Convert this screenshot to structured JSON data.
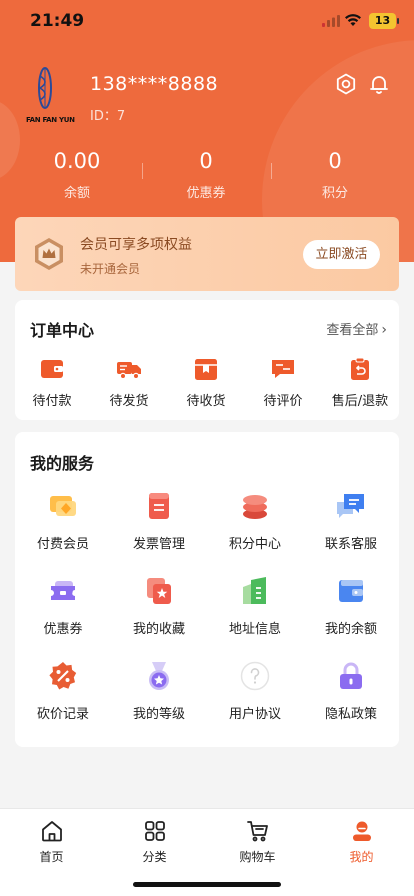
{
  "status_bar": {
    "time": "21:49",
    "battery": "13"
  },
  "profile": {
    "logo_text": "FAN FAN YUN",
    "phone": "138****8888",
    "user_id": "ID：7"
  },
  "stats": [
    {
      "value": "0.00",
      "label": "余额"
    },
    {
      "value": "0",
      "label": "优惠券"
    },
    {
      "value": "0",
      "label": "积分"
    }
  ],
  "vip": {
    "title": "会员可享多项权益",
    "subtitle": "未开通会员",
    "button": "立即激活"
  },
  "orders": {
    "title": "订单中心",
    "see_all": "查看全部",
    "items": [
      {
        "label": "待付款",
        "icon": "wallet-icon"
      },
      {
        "label": "待发货",
        "icon": "truck-icon"
      },
      {
        "label": "待收货",
        "icon": "package-icon"
      },
      {
        "label": "待评价",
        "icon": "review-icon"
      },
      {
        "label": "售后/退款",
        "icon": "refund-icon"
      }
    ]
  },
  "services": {
    "title": "我的服务",
    "items": [
      {
        "label": "付费会员",
        "icon": "membership-card-icon"
      },
      {
        "label": "发票管理",
        "icon": "invoice-icon"
      },
      {
        "label": "积分中心",
        "icon": "points-coins-icon"
      },
      {
        "label": "联系客服",
        "icon": "chat-bubble-icon"
      },
      {
        "label": "优惠券",
        "icon": "coupon-icon"
      },
      {
        "label": "我的收藏",
        "icon": "favorite-star-icon"
      },
      {
        "label": "地址信息",
        "icon": "building-icon"
      },
      {
        "label": "我的余额",
        "icon": "balance-wallet-icon"
      },
      {
        "label": "砍价记录",
        "icon": "discount-badge-icon"
      },
      {
        "label": "我的等级",
        "icon": "medal-icon"
      },
      {
        "label": "用户协议",
        "icon": "question-icon"
      },
      {
        "label": "隐私政策",
        "icon": "lock-icon"
      }
    ]
  },
  "tabbar": {
    "items": [
      {
        "label": "首页",
        "icon": "home-icon"
      },
      {
        "label": "分类",
        "icon": "grid-icon"
      },
      {
        "label": "购物车",
        "icon": "cart-icon"
      },
      {
        "label": "我的",
        "icon": "user-icon"
      }
    ],
    "active_index": 3
  },
  "colors": {
    "primary": "#ee6a3d",
    "accent": "#ee5a2b"
  }
}
